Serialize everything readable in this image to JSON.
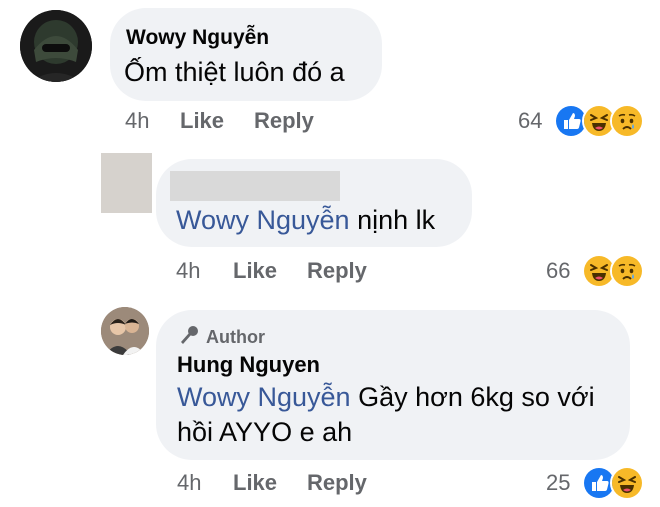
{
  "comments": [
    {
      "author": "Wowy Nguyễn",
      "text": "Ốm thiệt luôn đó a",
      "time": "4h",
      "like_label": "Like",
      "reply_label": "Reply",
      "reaction_count": "64",
      "reactions": [
        "like-icon",
        "haha-icon",
        "sad-icon"
      ]
    },
    {
      "author": "",
      "mention": "Wowy Nguyễn",
      "text": " nịnh lk",
      "time": "4h",
      "like_label": "Like",
      "reply_label": "Reply",
      "reaction_count": "66",
      "reactions": [
        "haha-icon",
        "sad-icon"
      ]
    },
    {
      "badge": "Author",
      "author": "Hung Nguyen",
      "mention": "Wowy Nguyễn",
      "text_line1": " Gầy hơn 6kg so với",
      "text_line2": "hồi AYYO e ah",
      "time": "4h",
      "like_label": "Like",
      "reply_label": "Reply",
      "reaction_count": "25",
      "reactions": [
        "like-icon",
        "haha-icon"
      ]
    }
  ],
  "colors": {
    "bubble": "#f0f2f5",
    "mention": "#385898",
    "meta": "#65676b",
    "like_blue": "#1877f2",
    "emoji_yellow": "#f7b928"
  }
}
